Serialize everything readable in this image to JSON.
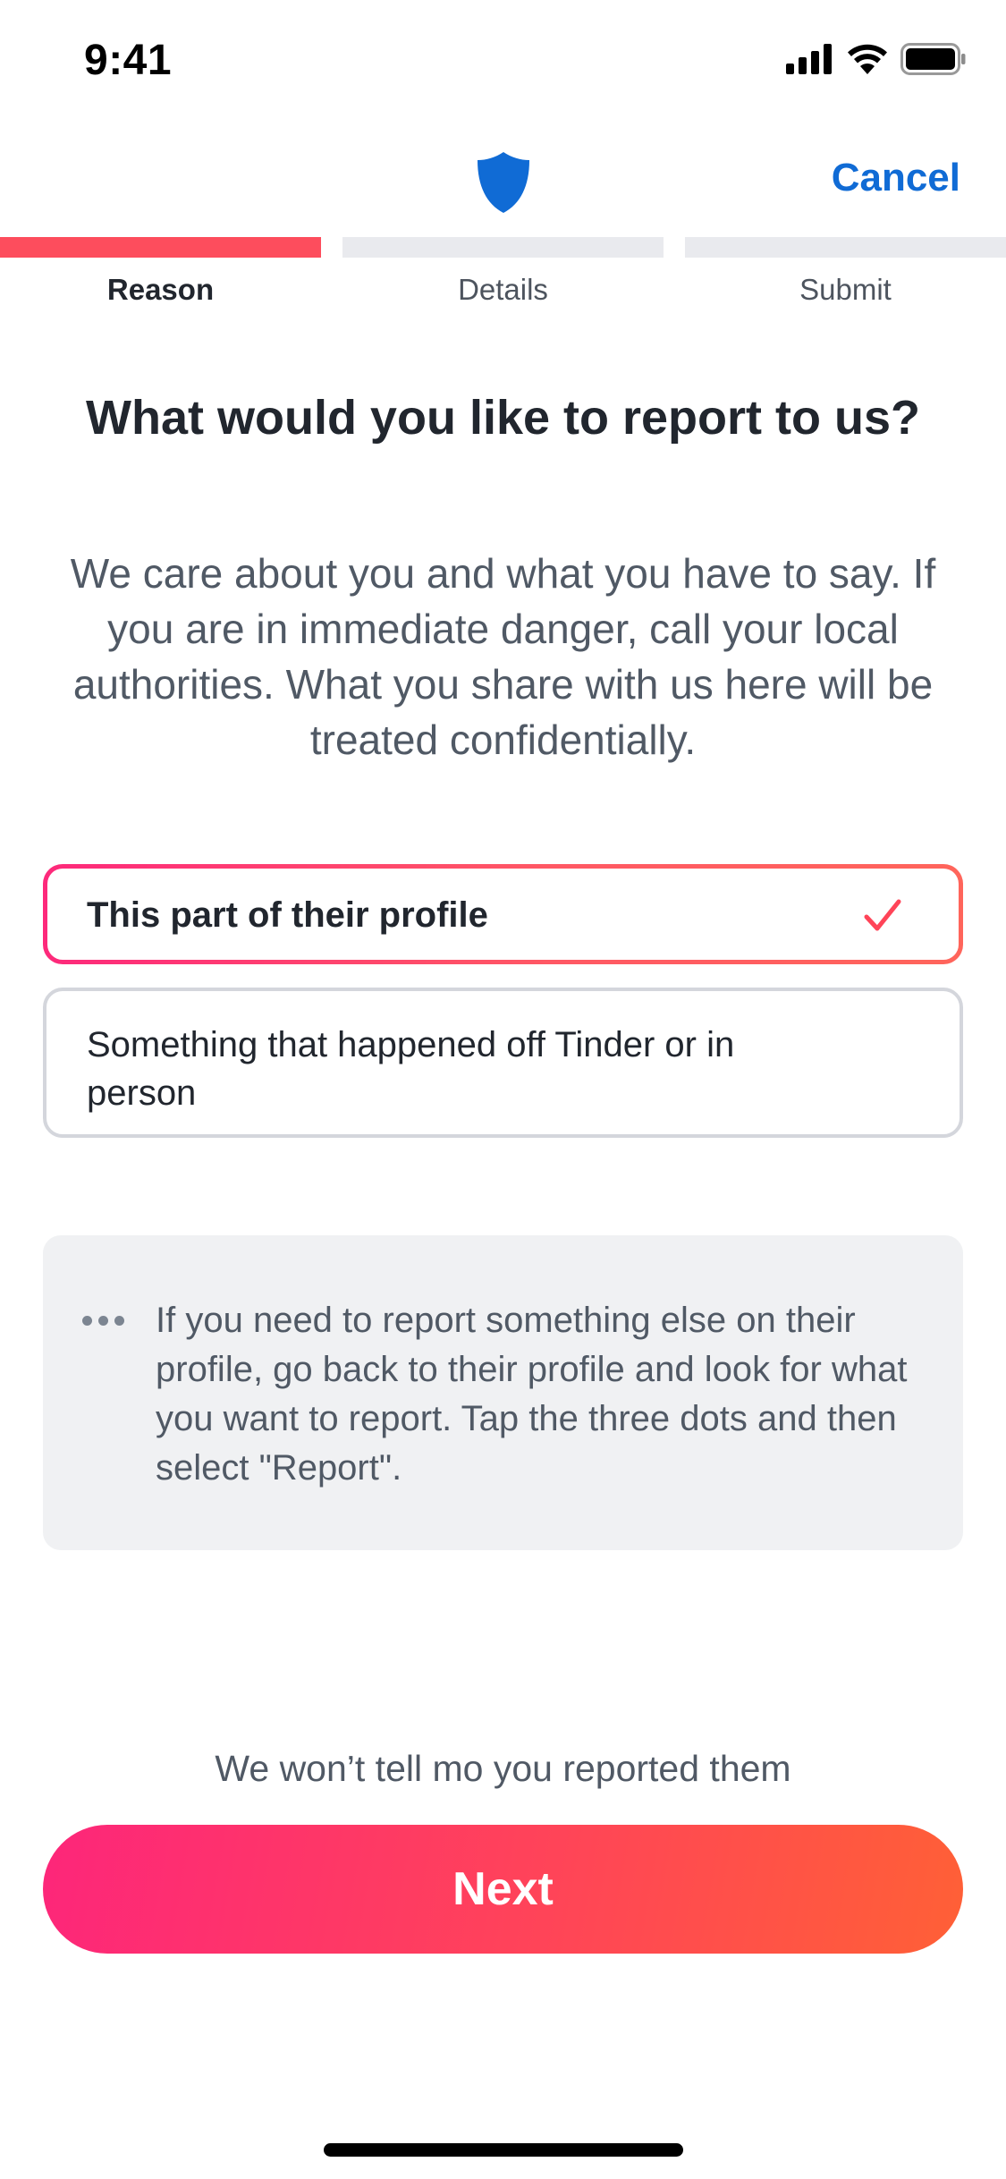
{
  "status_bar": {
    "time": "9:41",
    "icons": [
      "cellular-signal-icon",
      "wifi-icon",
      "battery-icon"
    ]
  },
  "header": {
    "icon": "shield-icon",
    "cancel_label": "Cancel"
  },
  "steps": [
    {
      "label": "Reason",
      "active": true
    },
    {
      "label": "Details",
      "active": false
    },
    {
      "label": "Submit",
      "active": false
    }
  ],
  "title": "What would you like to report to us?",
  "description": "We care about you and what you have to say. If you are in immediate danger, call your local authorities. What you share with us here will be treated confidentially.",
  "options": [
    {
      "label": "This part of their profile",
      "selected": true,
      "icon": "checkmark-icon"
    },
    {
      "label": "Something that happened off Tinder or in person",
      "selected": false
    }
  ],
  "info": {
    "icon": "more-dots-icon",
    "text": "If you need to report something else on their profile, go back to their profile and look for what you want to report. Tap the three dots and then select \"Report\"."
  },
  "footer": {
    "note": "We won’t tell mo you reported them",
    "next_label": "Next"
  },
  "colors": {
    "accent_blue": "#106bd5",
    "brand_red": "#fd4d5d",
    "gradient_start": "#fd267a",
    "gradient_end": "#ff6036"
  }
}
